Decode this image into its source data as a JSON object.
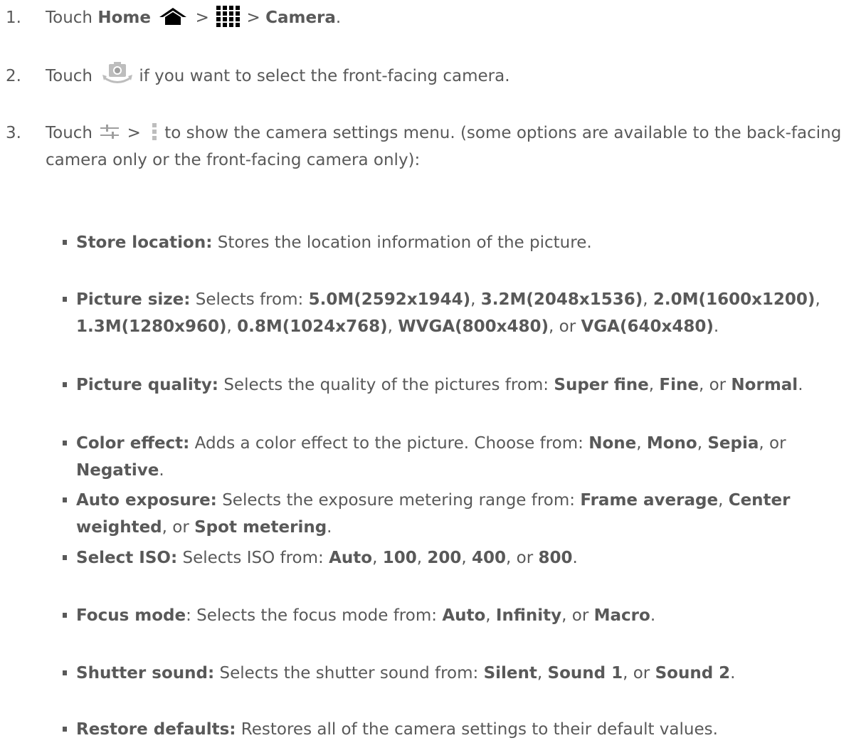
{
  "steps": [
    {
      "num": "1.",
      "pre": "Touch ",
      "home": "Home",
      "gt1": " > ",
      "gt2": " > ",
      "camera": "Camera",
      "end": "."
    },
    {
      "num": "2.",
      "pre": "Touch ",
      "post": "if you want to select the front-facing camera."
    },
    {
      "num": "3.",
      "pre": "Touch ",
      "gt": " > ",
      "post": "to show the camera settings menu. (some options are available to the back-facing camera only or the front-facing camera only):"
    }
  ],
  "bullets": [
    {
      "label": "Store location:",
      "desc": " Stores the location information of the picture."
    },
    {
      "label": "Picture size:",
      "desc": " Selects from: ",
      "options": [
        "5.0M(2592x1944)",
        "3.2M(2048x1536)",
        "2.0M(1600x1200)",
        "1.3M(1280x960)",
        "0.8M(1024x768)",
        "WVGA(800x480)",
        "VGA(640x480)"
      ]
    },
    {
      "label": "Picture quality:",
      "desc": " Selects the quality of the pictures from: ",
      "options": [
        "Super fine",
        "Fine",
        "Normal"
      ]
    },
    {
      "label": "Color effect:",
      "desc": " Adds a color effect to the picture. Choose from: ",
      "options": [
        "None",
        "Mono",
        "Sepia",
        "Negative"
      ]
    },
    {
      "label": "Auto exposure:",
      "desc": " Selects the exposure metering range from: ",
      "options": [
        "Frame average",
        "Center weighted",
        "Spot metering"
      ]
    },
    {
      "label": "Select ISO:",
      "desc": " Selects ISO from: ",
      "options": [
        "Auto",
        "100",
        "200",
        "400",
        "800"
      ]
    },
    {
      "label": "Focus mode",
      "desc": ": Selects the focus mode from: ",
      "options": [
        "Auto",
        "Infinity",
        "Macro"
      ]
    },
    {
      "label": "Shutter sound:",
      "desc": " Selects the shutter sound from: ",
      "options": [
        "Silent",
        "Sound 1",
        "Sound 2"
      ]
    },
    {
      "label": "Restore defaults:",
      "desc": " Restores all of the camera settings to their default values."
    }
  ],
  "separators": {
    "comma": ", ",
    "or": ", or ",
    "period": "."
  },
  "icons": {
    "home": "home-icon",
    "apps": "apps-grid-icon",
    "camera_switch": "camera-switch-icon",
    "settings": "sliders-icon",
    "menu": "menu-dots-icon"
  },
  "colors": {
    "text": "#595959",
    "icon_dark": "#000000",
    "icon_light": "#bdbdbd"
  }
}
